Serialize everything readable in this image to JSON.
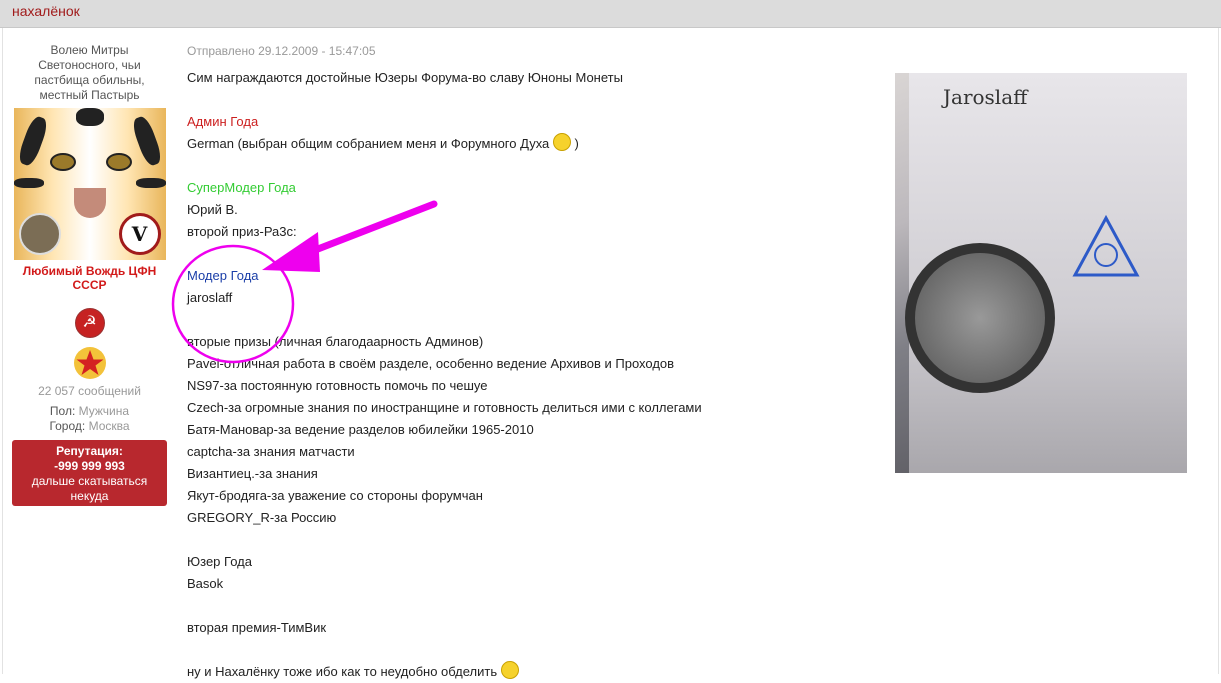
{
  "topbar": {
    "username": "нахалёнок"
  },
  "sidebar": {
    "motto": "Волею Митры Светоносного, чьи пастбища обильны, местный Пастырь",
    "rank": "Любимый Вождь ЦФН СССР",
    "posts": "22 057 сообщений",
    "gender_label": "Пол:",
    "gender_value": "Мужчина",
    "city_label": "Город:",
    "city_value": "Москва",
    "reputation_label": "Репутация:",
    "reputation_value": "-999 999 993",
    "reputation_note": "дальше скатываться некуда"
  },
  "post": {
    "date": "Отправлено 29.12.2009 - 15:47:05",
    "intro": "Сим награждаются достойные Юзеры Форума-во славу Юноны Монеты",
    "admin_title": "Админ Года",
    "admin_text": "German (выбран общим собранием меня и Форумного Духа",
    "admin_close": ")",
    "supermod_title": "СуперМодер Года",
    "supermod_name": "Юрий В.",
    "supermod_second": "второй приз-Ра3с:",
    "moder_title": "Модер Года",
    "moder_name": "jaroslaff",
    "second_prizes": "вторые призы (личная благодаарность Админов)",
    "p1": "Pavel-отличная работа в своём разделе, особенно ведение Архивов и Проходов",
    "p2": "NS97-за постоянную готовность помочь по чешуе",
    "p3": "Czech-за огромные знания по иностранщине и готовность делиться ими с коллегами",
    "p4": "Батя-Мановар-за ведение разделов юбилейки 1965-2010",
    "p5": "captcha-за знания матчасти",
    "p6": "Византиец.-за знания",
    "p7": "Якут-бродяга-за уважение со стороны форумчан",
    "p8": "GREGORY_R-за Россию",
    "user_title": "Юзер Года",
    "user_name": "Basok",
    "user_second": "вторая премия-ТимВик",
    "last_line": "ну и Нахалёнку тоже ибо как то неудобно обделить"
  },
  "photo": {
    "label": "Jaroslaff"
  },
  "colors": {
    "admin": "#cc1f1f",
    "supermod": "#33cc33",
    "moder": "#1a3ea8",
    "annotation": "#ee00ee",
    "reputation_bg": "#b8282e"
  }
}
